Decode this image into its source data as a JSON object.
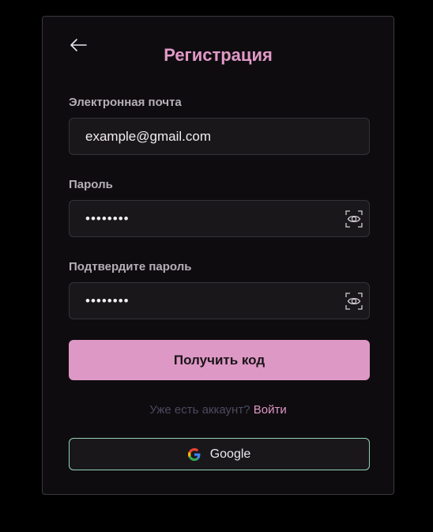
{
  "form": {
    "title": "Регистрация",
    "email": {
      "label": "Электронная почта",
      "value": "example@gmail.com"
    },
    "password": {
      "label": "Пароль",
      "value": "••••••••"
    },
    "confirm": {
      "label": "Подтвердите пароль",
      "value": "••••••••"
    },
    "submit_label": "Получить код",
    "login_prompt": "Уже есть аккаунт?",
    "login_link": "Войти",
    "google_label": "Google"
  },
  "icons": {
    "back": "arrow-left-icon",
    "toggle_visibility": "eye-icon",
    "google": "google-logo-icon"
  },
  "colors": {
    "accent": "#de98c5",
    "google_border": "#8fd3b0",
    "background": "#000000",
    "card": "#0f0c10"
  }
}
